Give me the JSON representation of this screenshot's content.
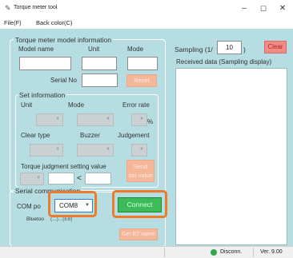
{
  "window": {
    "title": "Torque meter tool",
    "minimize": "–",
    "maximize": "☐",
    "close": "✕"
  },
  "menu": {
    "file": "File(F)",
    "file_key": "F",
    "back_color": "Back color(C)",
    "back_key": "C"
  },
  "model_info": {
    "legend": "Torque meter model information",
    "model_name_label": "Model name",
    "unit_label": "Unit",
    "mode_label": "Mode",
    "serial_no_label": "Serial No",
    "reset_label": "Reset"
  },
  "set_info": {
    "legend": "Set information",
    "unit_label": "Unit",
    "mode_label": "Mode",
    "error_rate_label": "Error rate",
    "percent": "%",
    "clear_type_label": "Clear type",
    "buzzer_label": "Buzzer",
    "judgement_label": "Judgement",
    "torque_judgment_label": "Torque judgment setting value",
    "lt": "<",
    "send_line1": "Send",
    "send_line2": "set value"
  },
  "serial": {
    "legend": "Serial communication",
    "com_port_label": "COM po",
    "com_port_value": "COM8",
    "connect_label": "Connect",
    "bluetooth_label": "Bluetoo",
    "bluetooth_partial": "(...)...(E8)",
    "get_bt_name_label": "Get BT name"
  },
  "sampling": {
    "label_prefix": "Sampling (1/",
    "value": "10",
    "label_suffix": ")",
    "clear_label": "Clear",
    "received_label": "Received data (Sampling display)"
  },
  "status": {
    "connection": "Disconn.",
    "version": "Ver. 9.00"
  },
  "colors": {
    "client_bg": "#b5dde2",
    "connect_green": "#3dbb5a",
    "highlight_orange": "#ee7a2a",
    "clear_red": "#f08b85",
    "status_dot_green": "#2ea84a"
  }
}
